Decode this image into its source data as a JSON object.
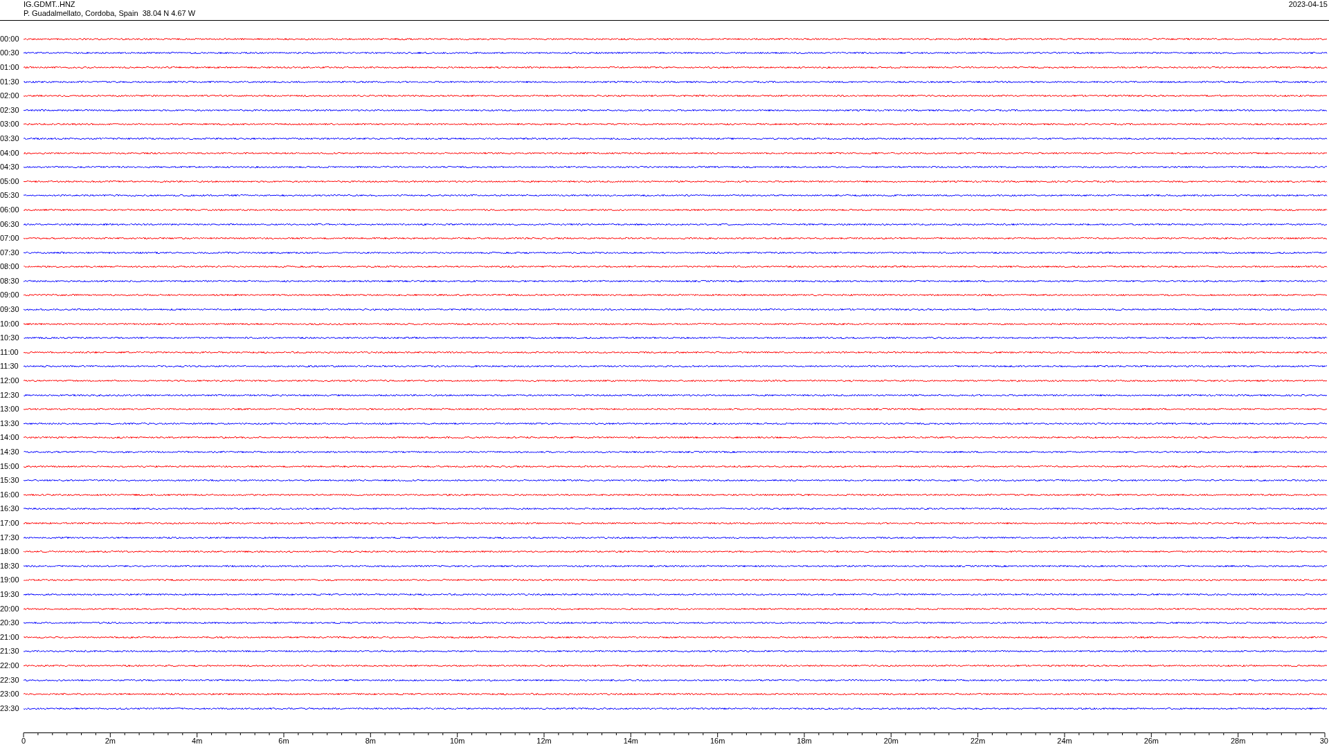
{
  "header": {
    "station": "IG.GDMT..HNZ",
    "location": "P. Guadalmellato, Cordoba, Spain  38.04 N 4.67 W",
    "date": "2023-04-15"
  },
  "traces": [
    {
      "time": "00:00",
      "color": "#ff0000"
    },
    {
      "time": "00:30",
      "color": "#0000ff"
    },
    {
      "time": "01:00",
      "color": "#ff0000"
    },
    {
      "time": "01:30",
      "color": "#0000ff"
    },
    {
      "time": "02:00",
      "color": "#ff0000"
    },
    {
      "time": "02:30",
      "color": "#0000ff"
    },
    {
      "time": "03:00",
      "color": "#ff0000"
    },
    {
      "time": "03:30",
      "color": "#0000ff"
    },
    {
      "time": "04:00",
      "color": "#ff0000"
    },
    {
      "time": "04:30",
      "color": "#0000ff"
    },
    {
      "time": "05:00",
      "color": "#ff0000"
    },
    {
      "time": "05:30",
      "color": "#0000ff"
    },
    {
      "time": "06:00",
      "color": "#ff0000"
    },
    {
      "time": "06:30",
      "color": "#0000ff"
    },
    {
      "time": "07:00",
      "color": "#ff0000"
    },
    {
      "time": "07:30",
      "color": "#0000ff"
    },
    {
      "time": "08:00",
      "color": "#ff0000"
    },
    {
      "time": "08:30",
      "color": "#0000ff"
    },
    {
      "time": "09:00",
      "color": "#ff0000"
    },
    {
      "time": "09:30",
      "color": "#0000ff"
    },
    {
      "time": "10:00",
      "color": "#ff0000"
    },
    {
      "time": "10:30",
      "color": "#0000ff"
    },
    {
      "time": "11:00",
      "color": "#ff0000"
    },
    {
      "time": "11:30",
      "color": "#0000ff"
    },
    {
      "time": "12:00",
      "color": "#ff0000"
    },
    {
      "time": "12:30",
      "color": "#0000ff"
    },
    {
      "time": "13:00",
      "color": "#ff0000"
    },
    {
      "time": "13:30",
      "color": "#0000ff"
    },
    {
      "time": "14:00",
      "color": "#ff0000"
    },
    {
      "time": "14:30",
      "color": "#0000ff"
    },
    {
      "time": "15:00",
      "color": "#ff0000"
    },
    {
      "time": "15:30",
      "color": "#0000ff"
    },
    {
      "time": "16:00",
      "color": "#ff0000"
    },
    {
      "time": "16:30",
      "color": "#0000ff"
    },
    {
      "time": "17:00",
      "color": "#ff0000"
    },
    {
      "time": "17:30",
      "color": "#0000ff"
    },
    {
      "time": "18:00",
      "color": "#ff0000"
    },
    {
      "time": "18:30",
      "color": "#0000ff"
    },
    {
      "time": "19:00",
      "color": "#ff0000"
    },
    {
      "time": "19:30",
      "color": "#0000ff"
    },
    {
      "time": "20:00",
      "color": "#ff0000"
    },
    {
      "time": "20:30",
      "color": "#0000ff"
    },
    {
      "time": "21:00",
      "color": "#ff0000"
    },
    {
      "time": "21:30",
      "color": "#0000ff"
    },
    {
      "time": "22:00",
      "color": "#ff0000"
    },
    {
      "time": "22:30",
      "color": "#0000ff"
    },
    {
      "time": "23:00",
      "color": "#ff0000"
    },
    {
      "time": "23:30",
      "color": "#0000ff"
    }
  ],
  "axis": {
    "tick_labels": [
      "0",
      "2m",
      "4m",
      "6m",
      "8m",
      "10m",
      "12m",
      "14m",
      "16m",
      "18m",
      "20m",
      "22m",
      "24m",
      "26m",
      "28m",
      "30"
    ]
  }
}
